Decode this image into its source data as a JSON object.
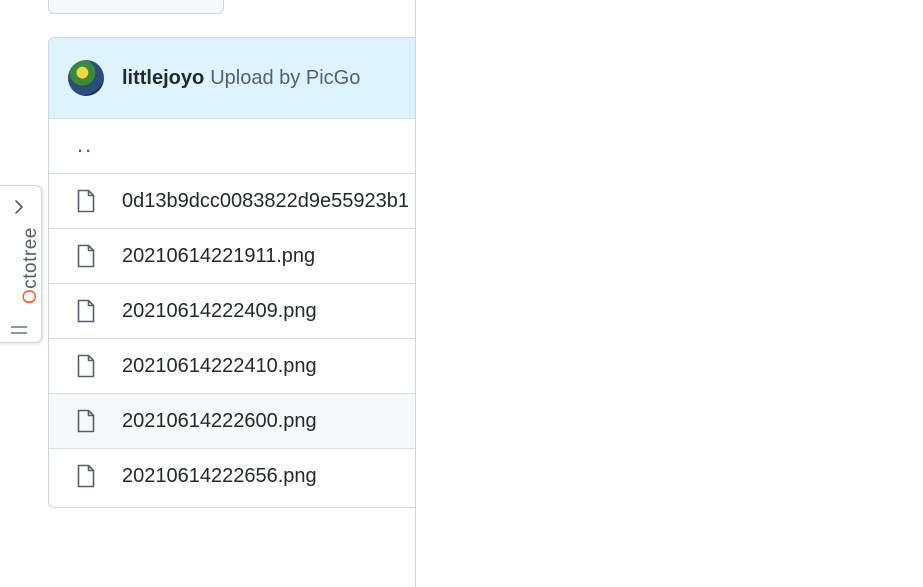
{
  "top": {
    "partial_text": "",
    "button_label": ""
  },
  "commit": {
    "author": "littlejoyo",
    "message": "Upload by PicGo"
  },
  "files": {
    "parent_label": "..",
    "items": [
      {
        "name": "0d13b9dcc0083822d9e55923b1",
        "icon": "file-icon"
      },
      {
        "name": "20210614221911.png",
        "icon": "file-icon"
      },
      {
        "name": "20210614222409.png",
        "icon": "file-icon"
      },
      {
        "name": "20210614222410.png",
        "icon": "file-icon"
      },
      {
        "name": "20210614222600.png",
        "icon": "file-icon",
        "hovered": true
      },
      {
        "name": "20210614222656.png",
        "icon": "file-icon"
      }
    ]
  },
  "octotree": {
    "label_first": "O",
    "label_rest": "ctotree",
    "toggle_icon": "chevron-right-icon",
    "handle_icon": "grip-icon",
    "accent_color": "#f0662a"
  }
}
